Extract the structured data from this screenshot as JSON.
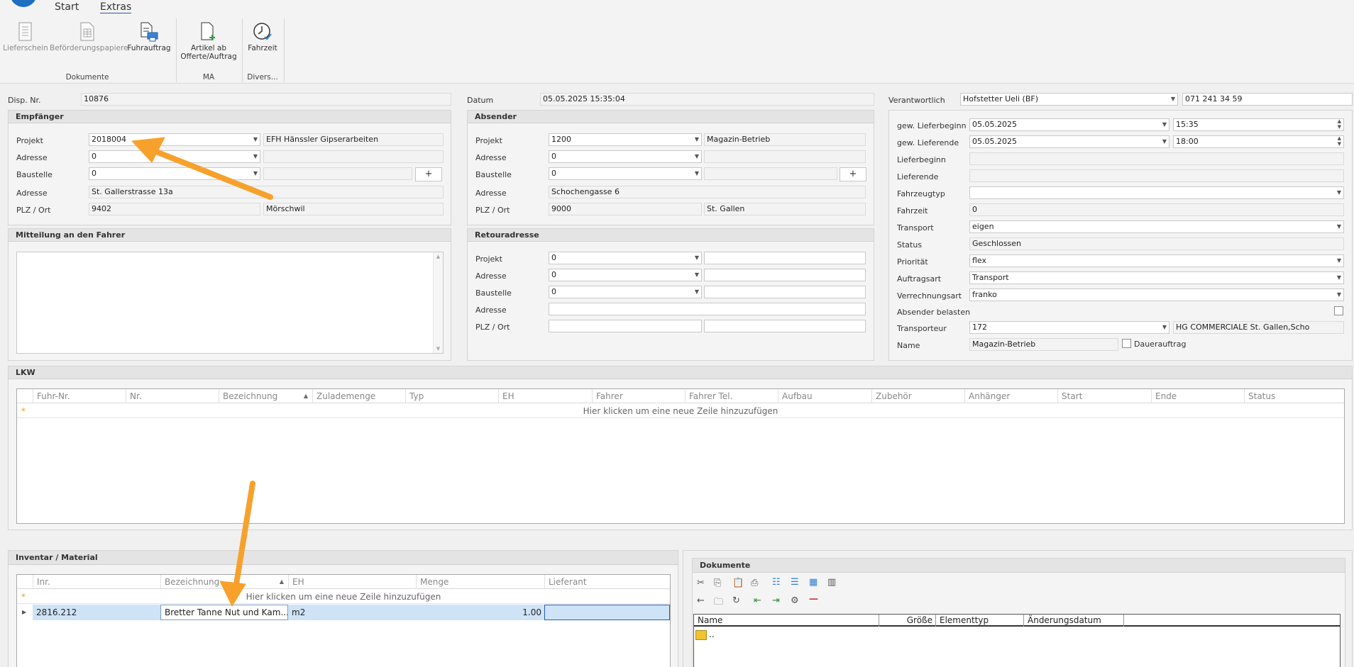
{
  "ribbon": {
    "tabs": [
      "Start",
      "Extras"
    ],
    "buttons": {
      "lieferschein": "Lieferschein",
      "befoerderung": "Beförderungspapiere",
      "fuhrauftrag": "Fuhrauftrag",
      "artikel_line1": "Artikel ab",
      "artikel_line2": "Offerte/Auftrag",
      "fahrzeit": "Fahrzeit"
    },
    "groups": {
      "dokumente": "Dokumente",
      "ma": "MA",
      "divers": "Divers..."
    }
  },
  "header": {
    "disp_label": "Disp. Nr.",
    "disp_value": "10876",
    "datum_label": "Datum",
    "datum_value": "05.05.2025 15:35:04",
    "verantw_label": "Verantwortlich",
    "verantw_value": "Hofstetter Ueli (BF)",
    "phone": "071 241 34 59"
  },
  "empfaenger": {
    "title": "Empfänger",
    "projekt_label": "Projekt",
    "projekt_value": "2018004",
    "projekt_name": "EFH Hänssler Gipserarbeiten",
    "adresse_label": "Adresse",
    "adresse_value": "0",
    "baustelle_label": "Baustelle",
    "baustelle_value": "0",
    "adresse2_label": "Adresse",
    "adresse2_value": "St. Gallerstrasse 13a",
    "plz_label": "PLZ / Ort",
    "plz_value": "9402",
    "ort_value": "Mörschwil",
    "plus": "+"
  },
  "absender": {
    "title": "Absender",
    "projekt_label": "Projekt",
    "projekt_value": "1200",
    "projekt_name": "Magazin-Betrieb",
    "adresse_label": "Adresse",
    "adresse_value": "0",
    "baustelle_label": "Baustelle",
    "baustelle_value": "0",
    "adresse2_label": "Adresse",
    "adresse2_value": "Schochengasse 6",
    "plz_label": "PLZ / Ort",
    "plz_value": "9000",
    "ort_value": "St. Gallen",
    "plus": "+"
  },
  "mitteilung": {
    "title": "Mitteilung an den Fahrer"
  },
  "retour": {
    "title": "Retouradresse",
    "projekt_label": "Projekt",
    "projekt_value": "0",
    "adresse_label": "Adresse",
    "adresse_value": "0",
    "baustelle_label": "Baustelle",
    "baustelle_value": "0",
    "adresse2_label": "Adresse",
    "plz_label": "PLZ / Ort"
  },
  "right": {
    "lieferbeginn_label": "gew. Lieferbeginn",
    "lieferbeginn_date": "05.05.2025",
    "lieferbeginn_time": "15:35",
    "lieferende_label": "gew. Lieferende",
    "lieferende_date": "05.05.2025",
    "lieferende_time": "18:00",
    "lb_label": "Lieferbeginn",
    "le_label": "Lieferende",
    "fahrzeugtyp_label": "Fahrzeugtyp",
    "fahrzeit_label": "Fahrzeit",
    "fahrzeit_value": "0",
    "transport_label": "Transport",
    "transport_value": "eigen",
    "status_label": "Status",
    "status_value": "Geschlossen",
    "prioritaet_label": "Priorität",
    "prioritaet_value": "flex",
    "auftragsart_label": "Auftragsart",
    "auftragsart_value": "Transport",
    "verrechnung_label": "Verrechnungsart",
    "verrechnung_value": "franko",
    "absender_bel_label": "Absender belasten",
    "transporteur_label": "Transporteur",
    "transporteur_value": "172",
    "transporteur_name": "HG COMMERCIALE St. Gallen,Scho",
    "name_label": "Name",
    "name_value": "Magazin-Betrieb",
    "dauerauftrag_label": "Dauerauftrag"
  },
  "lkw": {
    "title": "LKW",
    "columns": [
      "Fuhr-Nr.",
      "Nr.",
      "Bezeichnung",
      "Zulademenge",
      "Typ",
      "EH",
      "Fahrer",
      "Fahrer Tel.",
      "Aufbau",
      "Zubehör",
      "Anhänger",
      "Start",
      "Ende",
      "Status"
    ],
    "new_row": "Hier klicken um eine neue Zeile hinzuzufügen"
  },
  "inventar": {
    "title": "Inventar / Material",
    "columns": [
      "Inr.",
      "Bezeichnung",
      "EH",
      "Menge",
      "Lieferant"
    ],
    "new_row": "Hier klicken um eine neue Zeile hinzuzufügen",
    "rows": [
      {
        "inr": "2816.212",
        "bezeichnung": "Bretter Tanne Nut und Kam...",
        "eh": "m2",
        "menge": "1.00",
        "lieferant": ""
      }
    ]
  },
  "dokumente": {
    "title": "Dokumente",
    "columns": [
      "Name",
      "Größe",
      "Elementtyp",
      "Änderungsdatum"
    ],
    "rows": [
      {
        "name": ".."
      }
    ]
  },
  "colors": {
    "accent": "#2a5caa",
    "arrow": "#f7a12c",
    "selected_row": "#cfe3f7",
    "star": "#f29b1e"
  }
}
